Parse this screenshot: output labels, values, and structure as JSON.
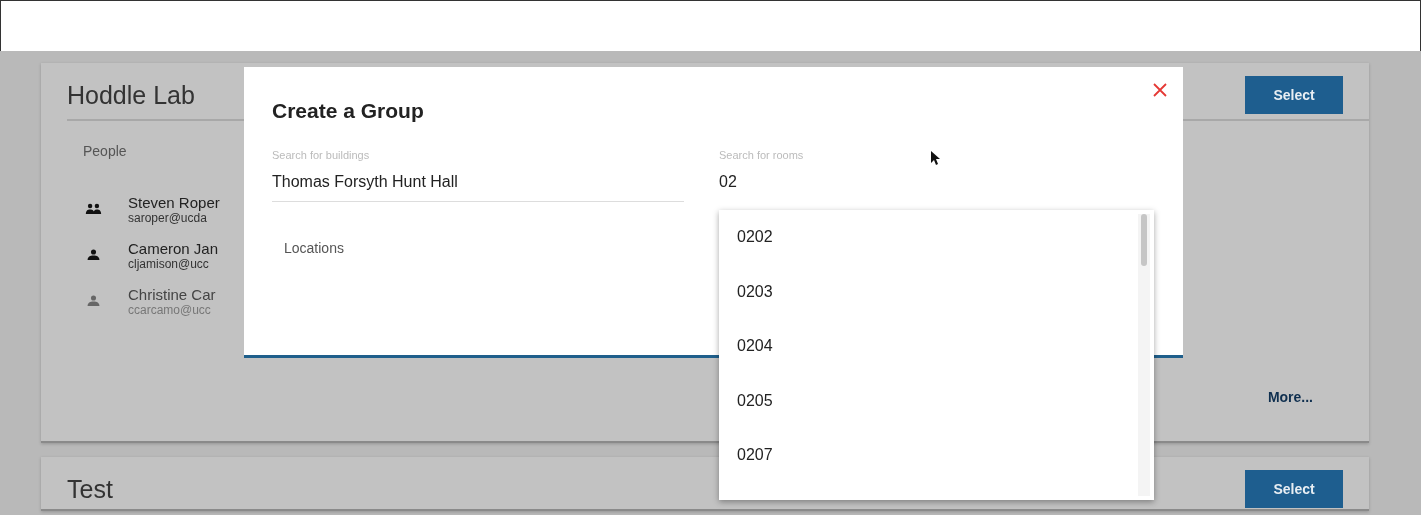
{
  "cards": [
    {
      "title": "Hoddle Lab",
      "button": "Select",
      "section": "People",
      "people": [
        {
          "kind": "group",
          "name": "Steven Roper",
          "email": "saroper@ucda",
          "dimmed": false
        },
        {
          "kind": "person",
          "name": "Cameron Jan",
          "email": "cljamison@ucc",
          "dimmed": false
        },
        {
          "kind": "person",
          "name": "Christine Car",
          "email": "ccarcamo@ucc",
          "dimmed": true
        }
      ],
      "more": "More..."
    },
    {
      "title": "Test",
      "button": "Select"
    }
  ],
  "dialog": {
    "title": "Create a Group",
    "buildings": {
      "label": "Search for buildings",
      "value": "Thomas Forsyth Hunt Hall"
    },
    "rooms": {
      "label": "Search for rooms",
      "value": "02"
    },
    "locations": "Locations",
    "room_options": [
      "0202",
      "0203",
      "0204",
      "0205",
      "0207"
    ]
  }
}
